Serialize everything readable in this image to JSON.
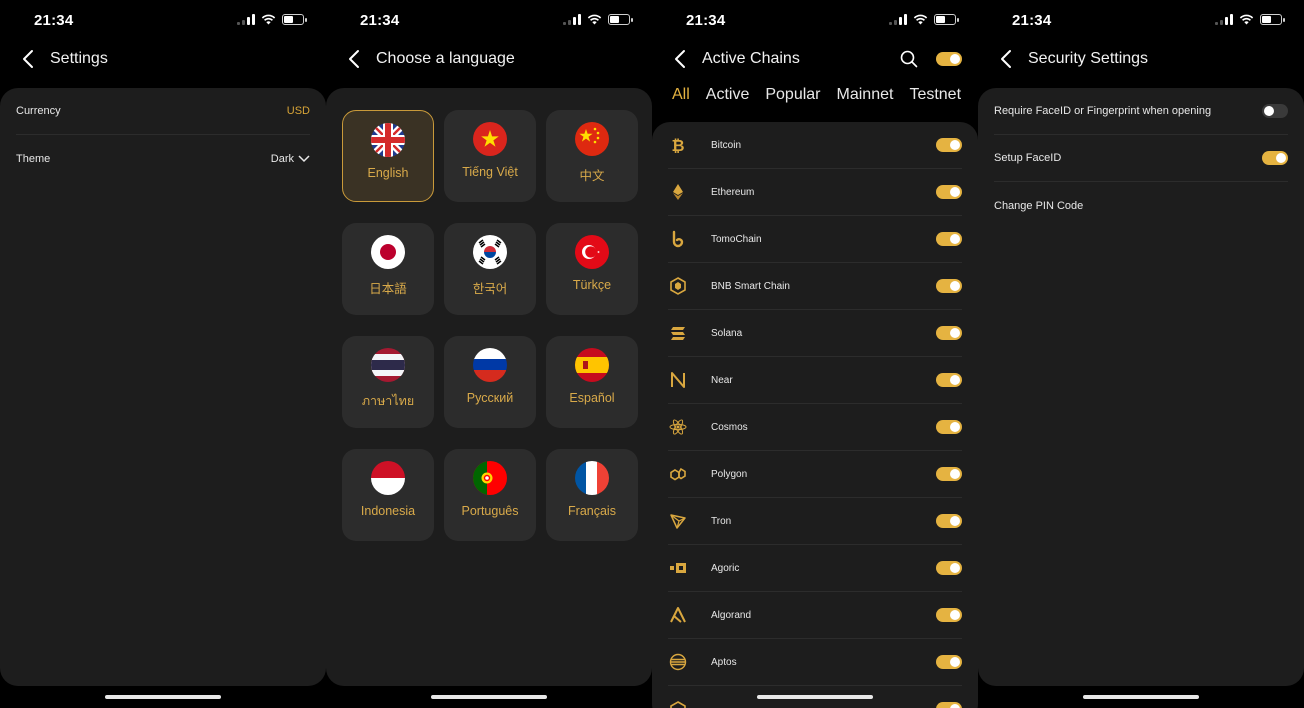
{
  "status": {
    "time": "21:34"
  },
  "settings": {
    "title": "Settings",
    "currency_label": "Currency",
    "currency_value": "USD",
    "theme_label": "Theme",
    "theme_value": "Dark"
  },
  "language": {
    "title": "Choose a language",
    "selected": "English",
    "items": [
      {
        "label": "English",
        "flag": "uk-flag"
      },
      {
        "label": "Tiếng Việt",
        "flag": "vietnam-flag"
      },
      {
        "label": "中文",
        "flag": "china-flag"
      },
      {
        "label": "日本語",
        "flag": "japan-flag"
      },
      {
        "label": "한국어",
        "flag": "korea-flag"
      },
      {
        "label": "Türkçe",
        "flag": "turkey-flag"
      },
      {
        "label": "ภาษาไทย",
        "flag": "thailand-flag"
      },
      {
        "label": "Русский",
        "flag": "russia-flag"
      },
      {
        "label": "Español",
        "flag": "spain-flag"
      },
      {
        "label": "Indonesia",
        "flag": "indonesia-flag"
      },
      {
        "label": "Português",
        "flag": "portugal-flag"
      },
      {
        "label": "Français",
        "flag": "france-flag"
      }
    ]
  },
  "chains": {
    "title": "Active Chains",
    "tabs": [
      "All",
      "Active",
      "Popular",
      "Mainnet",
      "Testnet"
    ],
    "active_tab": "All",
    "items": [
      {
        "name": "Bitcoin",
        "icon": "bitcoin-icon",
        "enabled": true
      },
      {
        "name": "Ethereum",
        "icon": "ethereum-icon",
        "enabled": true
      },
      {
        "name": "TomoChain",
        "icon": "tomochain-icon",
        "enabled": true
      },
      {
        "name": "BNB Smart Chain",
        "icon": "bnb-icon",
        "enabled": true
      },
      {
        "name": "Solana",
        "icon": "solana-icon",
        "enabled": true
      },
      {
        "name": "Near",
        "icon": "near-icon",
        "enabled": true
      },
      {
        "name": "Cosmos",
        "icon": "cosmos-icon",
        "enabled": true
      },
      {
        "name": "Polygon",
        "icon": "polygon-icon",
        "enabled": true
      },
      {
        "name": "Tron",
        "icon": "tron-icon",
        "enabled": true
      },
      {
        "name": "Agoric",
        "icon": "agoric-icon",
        "enabled": true
      },
      {
        "name": "Algorand",
        "icon": "algorand-icon",
        "enabled": true
      },
      {
        "name": "Aptos",
        "icon": "aptos-icon",
        "enabled": true
      },
      {
        "name": "",
        "icon": "chain-icon",
        "enabled": true
      }
    ]
  },
  "security": {
    "title": "Security Settings",
    "require_faceid_label": "Require FaceID or Fingerprint when opening",
    "require_faceid_enabled": false,
    "setup_faceid_label": "Setup FaceID",
    "setup_faceid_enabled": true,
    "change_pin_label": "Change PIN Code"
  },
  "colors": {
    "accent": "#e5b341",
    "panel": "#1d1d1d",
    "background": "#000000"
  }
}
